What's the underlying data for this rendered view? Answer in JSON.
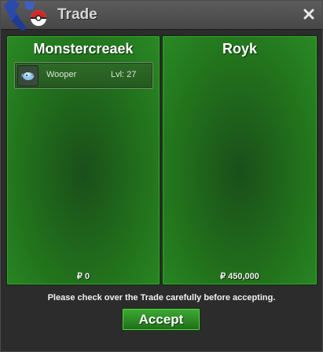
{
  "window": {
    "title": "Trade",
    "close_icon": "close-icon"
  },
  "trade": {
    "left": {
      "name": "Monstercreaek",
      "items": [
        {
          "name": "Wooper",
          "level": "Lvl: 27",
          "icon": "wooper-icon"
        }
      ],
      "money": "₽ 0"
    },
    "right": {
      "name": "Royk",
      "items": [],
      "money": "₽ 450,000"
    }
  },
  "notice": "Please check over the Trade carefully before accepting.",
  "accept_label": "Accept",
  "colors": {
    "panel_green": "#22731c",
    "accept_green": "#2f8f28",
    "titlebar": "#525252"
  }
}
